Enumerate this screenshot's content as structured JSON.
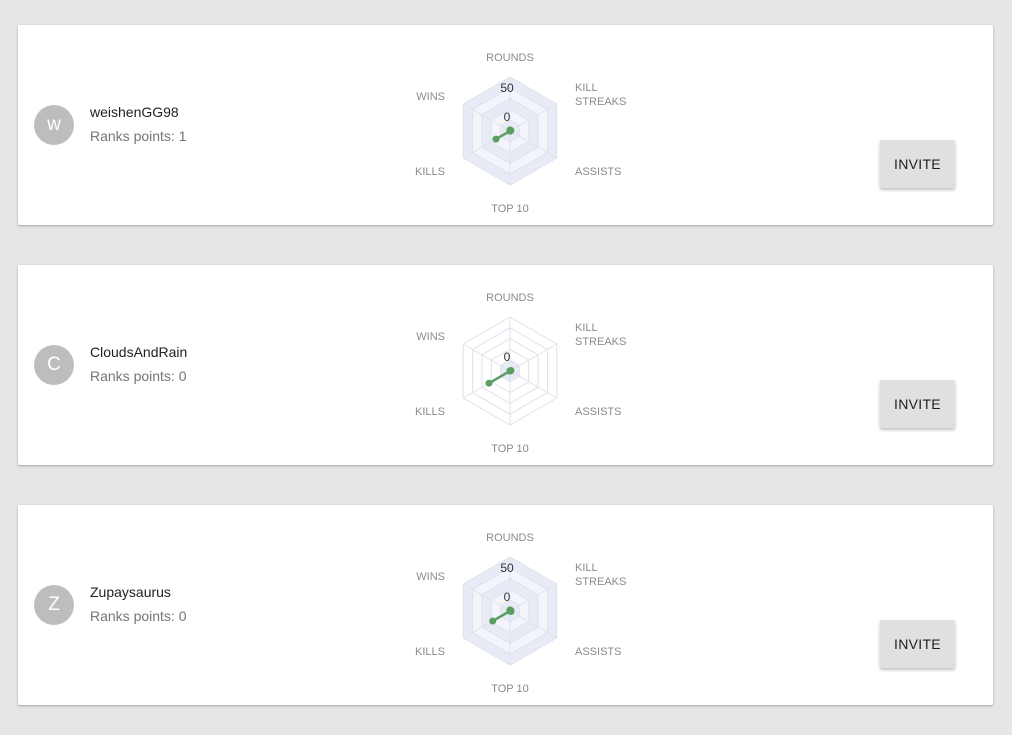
{
  "invite_label": "INVITE",
  "ranks_prefix": "Ranks points: ",
  "radar": {
    "axes": [
      "ROUNDS",
      "KILL STREAKS",
      "ASSISTS",
      "TOP 10",
      "KILLS",
      "WINS"
    ],
    "colors": {
      "stroke": "#5a9e62",
      "grid_fill": "#e8ebf5",
      "grid_line": "#dfe2ec"
    }
  },
  "players": [
    {
      "username": "weishenGG98",
      "initial": "w",
      "ranks_points": "1",
      "shaded_grid": true,
      "scale_labels": [
        "50",
        "0"
      ],
      "stats": {
        "ROUNDS": 2,
        "KILL STREAKS": 2,
        "ASSISTS": 0,
        "TOP 10": 0,
        "KILLS": 30,
        "WINS": 0
      }
    },
    {
      "username": "CloudsAndRain",
      "initial": "C",
      "ranks_points": "0",
      "shaded_grid": false,
      "scale_labels": [
        "0"
      ],
      "stats": {
        "ROUNDS": 0,
        "KILL STREAKS": 2,
        "ASSISTS": 0,
        "TOP 10": 0,
        "KILLS": 45,
        "WINS": 0
      }
    },
    {
      "username": "Zupaysaurus",
      "initial": "Z",
      "ranks_points": "0",
      "shaded_grid": true,
      "scale_labels": [
        "50",
        "0"
      ],
      "stats": {
        "ROUNDS": 2,
        "KILL STREAKS": 2,
        "ASSISTS": 2,
        "TOP 10": 0,
        "KILLS": 37,
        "WINS": 0
      }
    }
  ]
}
